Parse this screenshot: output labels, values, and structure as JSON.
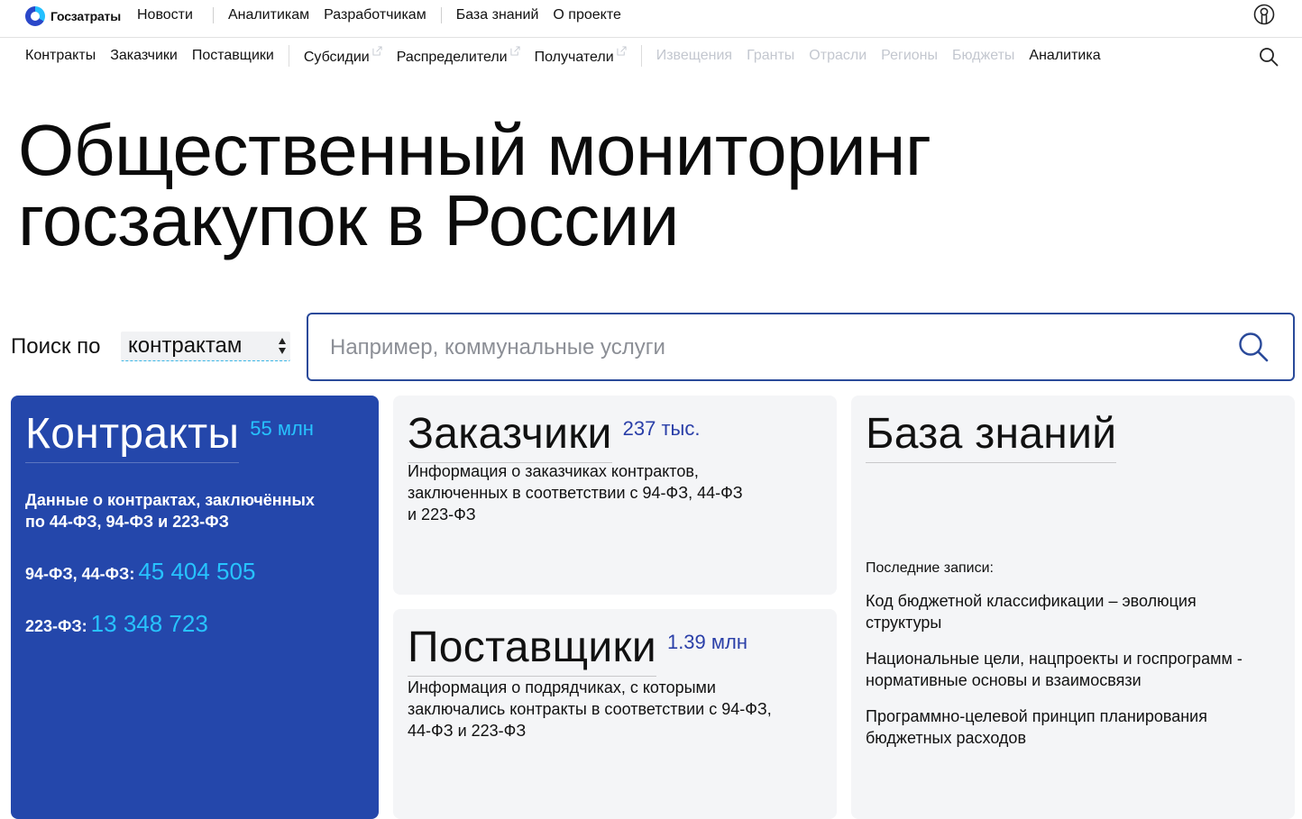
{
  "logo": {
    "text": "Госзатраты"
  },
  "top_nav": {
    "news": "Новости",
    "analysts": "Аналитикам",
    "developers": "Разработчикам",
    "knowledge_base": "База знаний",
    "about": "О проекте"
  },
  "sub_nav": {
    "contracts": "Контракты",
    "customers": "Заказчики",
    "suppliers": "Поставщики",
    "subsidies": "Субсидии",
    "distributors": "Распределители",
    "recipients": "Получатели",
    "notices": "Извещения",
    "grants": "Гранты",
    "industries": "Отрасли",
    "regions": "Регионы",
    "budgets": "Бюджеты",
    "analytics": "Аналитика"
  },
  "hero": {
    "line1": "Общественный мониторинг",
    "line2": "госзакупок в России"
  },
  "search": {
    "label": "Поиск по",
    "selected": "контрактам",
    "placeholder": "Например, коммунальные услуги"
  },
  "cards": {
    "contracts": {
      "title": "Контракты",
      "count": "55 млн",
      "desc_line1": "Данные о контрактах, заключённых",
      "desc_line2": "по 44-ФЗ, 94-ФЗ и 223-ФЗ",
      "stat1_label": "94-ФЗ, 44-ФЗ:",
      "stat1_value": "45 404 505",
      "stat2_label": "223-ФЗ:",
      "stat2_value": "13 348 723"
    },
    "customers": {
      "title": "Заказчики",
      "count": "237 тыс.",
      "desc_line1": "Информация о заказчиках контрактов,",
      "desc_line2": "заключенных в соответствии с 94-ФЗ, 44-ФЗ",
      "desc_line3": "и 223-ФЗ"
    },
    "suppliers": {
      "title": "Поставщики",
      "count": "1.39 млн",
      "desc_line1": "Информация о подрядчиках, с которыми",
      "desc_line2": "заключались контракты в соответствии с 94-ФЗ,",
      "desc_line3": "44-ФЗ и 223-ФЗ"
    },
    "knowledge": {
      "title": "База знаний",
      "latest_label": "Последние записи:",
      "entries": [
        "Код бюджетной классификации – эволюция структуры",
        "Национальные цели, нацпроекты и госпрограмм - нормативные основы и взаимосвязи",
        "Программно-целевой принцип планирования бюджетных расходов"
      ]
    }
  },
  "colors": {
    "primary": "#2447ab",
    "accent": "#27c3ff",
    "card_bg": "#f4f5f7",
    "disabled": "#c3c7cf"
  },
  "icons": {
    "user": "user-icon",
    "search": "search-icon",
    "external": "external-link-icon"
  }
}
